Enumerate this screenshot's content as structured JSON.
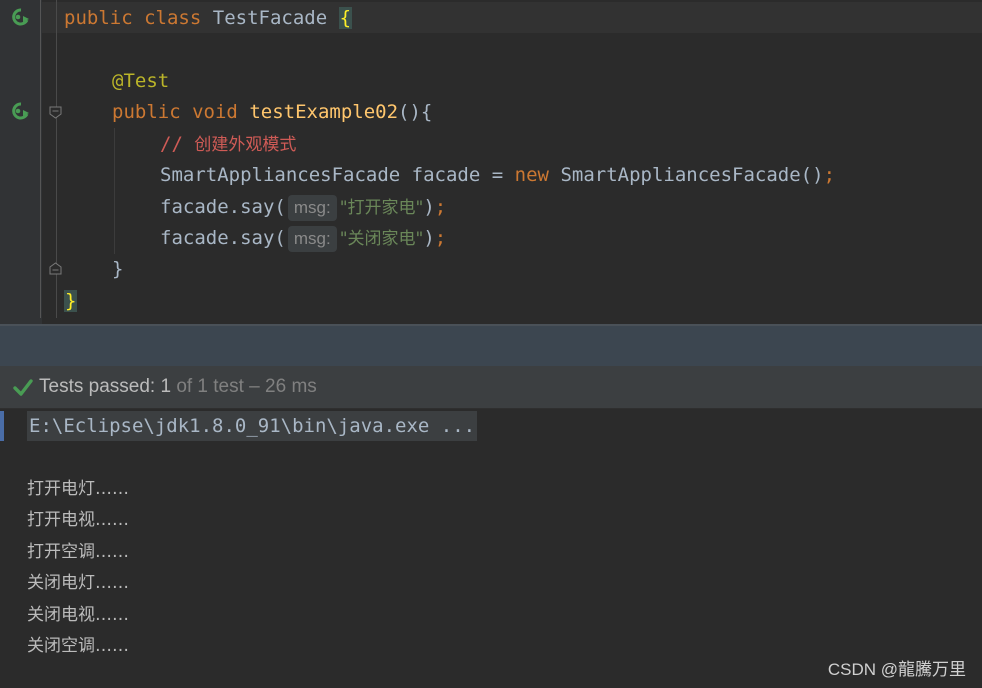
{
  "editor": {
    "line1": {
      "kw1": "public",
      "kw2": "class",
      "name": "TestFacade",
      "brace": "{"
    },
    "annotation": "@Test",
    "line3": {
      "kw1": "public",
      "kw2": "void",
      "name": "testExample02",
      "rest": "(){"
    },
    "comment": {
      "slashes": "//",
      "text": "创建外观模式"
    },
    "line5": {
      "type": "SmartAppliancesFacade",
      "var": "facade",
      "eq": "=",
      "new_kw": "new",
      "ctor": "SmartAppliancesFacade",
      "parens": "()",
      "semi": ";"
    },
    "call1": {
      "target": "facade.say(",
      "hint": "msg:",
      "arg": "\"打开家电\"",
      "close": ")",
      "semi": ";"
    },
    "call2": {
      "target": "facade.say(",
      "hint": "msg:",
      "arg": "\"关闭家电\"",
      "close": ")",
      "semi": ";"
    },
    "method_close": "}",
    "class_close": "}"
  },
  "icons": {
    "run_class": "run-test-icon",
    "run_method": "run-test-icon",
    "fold_method_start": "fold-icon",
    "fold_method_end": "fold-icon",
    "status_check": "check-icon"
  },
  "status": {
    "prefix": "Tests passed:",
    "passed": "1",
    "rest": "of 1 test – 26 ms"
  },
  "console": {
    "command": "E:\\Eclipse\\jdk1.8.0_91\\bin\\java.exe ...",
    "lines": [
      "打开电灯……",
      "打开电视……",
      "打开空调……",
      "关闭电灯……",
      "关闭电视……",
      "关闭空调……"
    ]
  },
  "watermark": "CSDN @龍騰万里",
  "colors": {
    "background": "#2b2b2b",
    "keyword": "#cc7832",
    "string": "#6a8759",
    "annotation": "#bbb529",
    "method": "#ffc66d",
    "comment": "#cf5b56",
    "success": "#499c54"
  }
}
